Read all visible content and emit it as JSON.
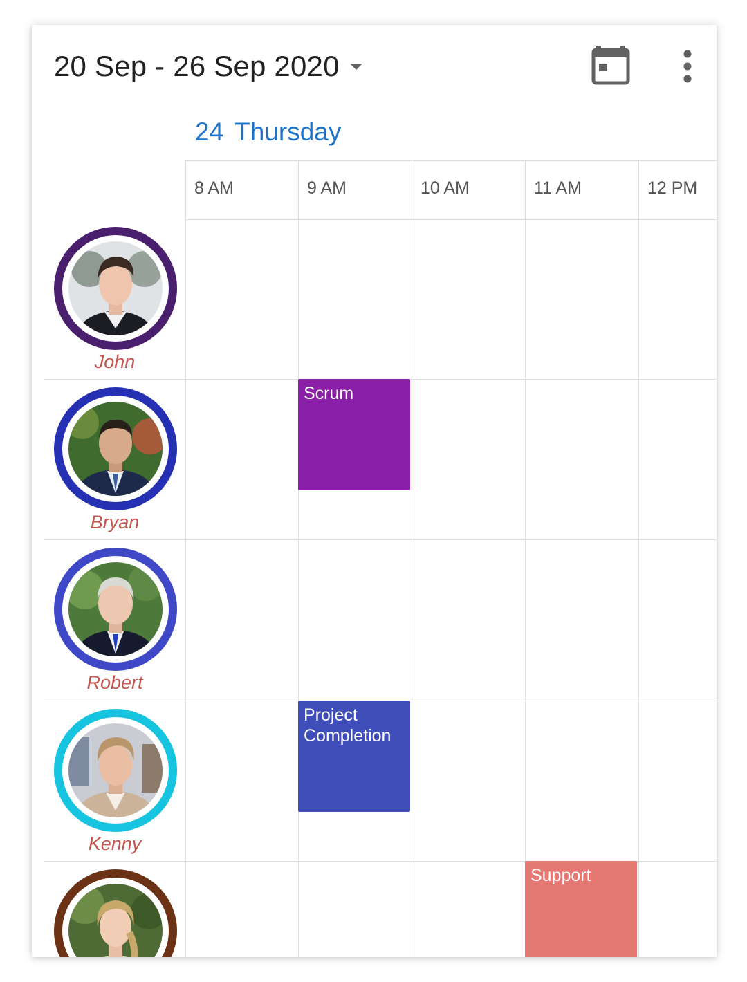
{
  "header": {
    "date_range": "20 Sep - 26 Sep 2020",
    "today_icon": "calendar-today-icon",
    "more_icon": "more-vert-icon"
  },
  "day": {
    "number": "24",
    "name": "Thursday"
  },
  "time_slots": [
    "8 AM",
    "9 AM",
    "10 AM",
    "11 AM",
    "12 PM"
  ],
  "resources": [
    {
      "name": "John",
      "ring_color": "#4a1f6e"
    },
    {
      "name": "Bryan",
      "ring_color": "#2630b3"
    },
    {
      "name": "Robert",
      "ring_color": "#3f48c7"
    },
    {
      "name": "Kenny",
      "ring_color": "#16c4e0"
    },
    {
      "name": "",
      "ring_color": "#6b3216"
    }
  ],
  "appointments": [
    {
      "title": "Scrum",
      "resource": "Bryan",
      "start": "9 AM",
      "end": "10 AM",
      "color": "#8a1fa8"
    },
    {
      "title": "Project Completion",
      "resource": "Kenny",
      "start": "9 AM",
      "end": "10 AM",
      "color": "#3f4db8"
    },
    {
      "title": "Support",
      "resource": "",
      "start": "11 AM",
      "end": "12 PM",
      "color": "#e57872"
    }
  ],
  "colors": {
    "accent": "#1e73c8",
    "name_text": "#c5554f",
    "grid": "#e0e0e0"
  }
}
